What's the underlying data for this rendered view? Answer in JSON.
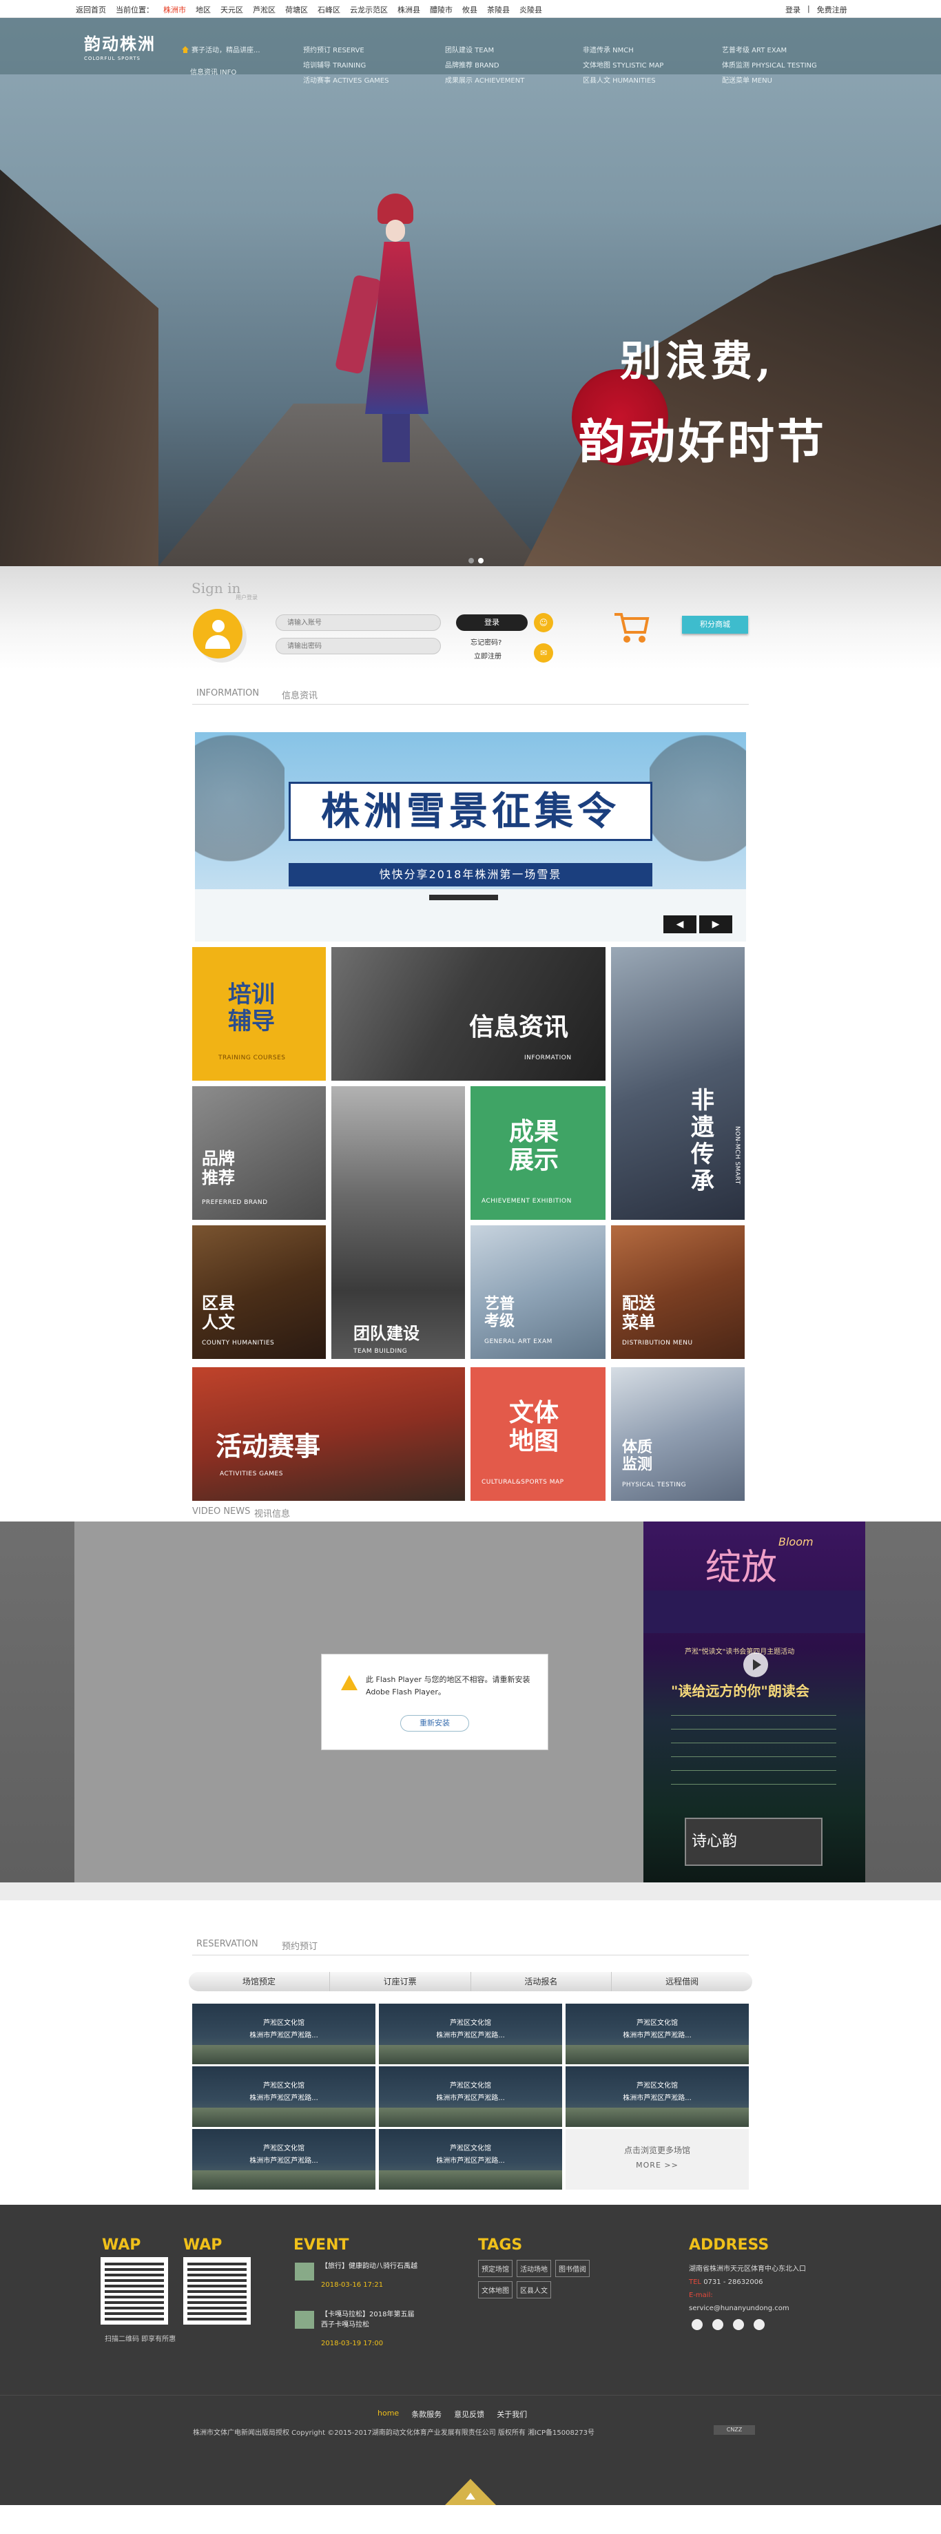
{
  "topbar": {
    "links": [
      "返回首页",
      "当前位置：",
      "株洲市",
      "地区",
      "天元区",
      "芦淞区",
      "荷塘区",
      "石峰区",
      "云龙示范区",
      "株洲县",
      "醴陵市",
      "攸县",
      "茶陵县",
      "炎陵县"
    ],
    "login": "登录",
    "divider": "|",
    "register": "免费注册"
  },
  "logo": {
    "cn": "韵动株洲",
    "en": "COLORFUL SPORTS"
  },
  "nav": {
    "home": "赛子活动，精品讲座...",
    "info": "信息资讯 INFO",
    "reserve": "预约预订 RESERVE",
    "training": "培训辅导 TRAINING",
    "activities": "活动赛事 ACTIVES GAMES",
    "team": "团队建设 TEAM",
    "brand": "品牌推荐 BRAND",
    "achievement": "成果展示 ACHIEVEMENT",
    "nmch": "非遗传承 NMCH",
    "map": "文体地图 STYLISTIC MAP",
    "humanities": "区县人文 HUMANITIES",
    "artexam": "艺普考级 ART EXAM",
    "physical": "体质监测 PHYSICAL TESTING",
    "menu": "配送菜单 MENU"
  },
  "hero": {
    "line1": "别浪费,",
    "line2": "韵动好时节"
  },
  "signin": {
    "title": "Sign in",
    "subtitle": "用户登录",
    "account_placeholder": "请输入账号",
    "password_placeholder": "请输出密码",
    "login": "登录",
    "forgot": "忘记密码?",
    "register": "立即注册",
    "points": "积分商城"
  },
  "info": {
    "en": "INFORMATION",
    "cn": "信息资讯"
  },
  "banner": {
    "title": "株洲雪景征集令",
    "subtitle": "快快分享2018年株洲第一场雪景",
    "prev": "◀",
    "next": "▶"
  },
  "tiles": [
    {
      "cn": "培训\n辅导",
      "en": "TRAINING COURSES"
    },
    {
      "cn": "信息资讯",
      "en": "INFORMATION"
    },
    {
      "cn": "非\n遗\n传\n承",
      "en": "NON-MCH SMART"
    },
    {
      "cn": "品牌\n推荐",
      "en": "PREFERRED BRAND"
    },
    {
      "cn": "成果\n展示",
      "en": "ACHIEVEMENT EXHIBITION"
    },
    {
      "cn": "区县\n人文",
      "en": "COUNTY HUMANITIES"
    },
    {
      "cn": "团队建设",
      "en": "TEAM BUILDING"
    },
    {
      "cn": "艺普\n考级",
      "en": "GENERAL ART EXAM"
    },
    {
      "cn": "配送\n菜单",
      "en": "DISTRIBUTION MENU"
    },
    {
      "cn": "活动赛事",
      "en": "ACTIVITIES GAMES"
    },
    {
      "cn": "文体\n地图",
      "en": "CULTURAL&SPORTS MAP"
    },
    {
      "cn": "体质\n监测",
      "en": "PHYSICAL TESTING"
    }
  ],
  "video": {
    "en": "VIDEO NEWS",
    "cn": "视讯信息",
    "flash_msg": "此 Flash Player 与您的地区不相容。请重新安装 Adobe Flash Player。",
    "reinstall": "重新安装",
    "poster_title": "绽放",
    "poster_en": "Bloom",
    "poster_reading": "\"读给远方的你\"朗读会",
    "poster_sub": "芦淞\"悦读文\"读书会第四月主题活动",
    "poster_screen": "诗心韵"
  },
  "reservation": {
    "en": "RESERVATION",
    "cn": "预约预订",
    "tabs": [
      "场馆预定",
      "订座订票",
      "活动报名",
      "远程借阅"
    ],
    "venue_line1": "芦淞区文化馆",
    "venue_line2": "株洲市芦淞区芦淞路...",
    "more_text": "点击浏览更多场馆",
    "more_link": "MORE >>"
  },
  "footer": {
    "wap1": "WAP",
    "wap2": "WAP",
    "qr_text": "扫描二维码  即享有所惠",
    "event_title": "EVENT",
    "event1": "【旅行】健康韵动八骑行石禹越",
    "event1_date": "2018-03-16 17:21",
    "event2": "【卡嘎马拉松】2018年第五届西子卡嘎马拉松",
    "event2_date": "2018-03-19 17:00",
    "tags_title": "TAGS",
    "tags": [
      "预定场馆",
      "活动场地",
      "图书借阅",
      "文体地图",
      "区县人文"
    ],
    "addr_title": "ADDRESS",
    "addr": "湖南省株洲市天元区体育中心东北入口",
    "tel_label": "TEL",
    "tel": "0731 - 28632006",
    "email_label": "E-mail:",
    "email": "service@hunanyundong.com",
    "links": [
      "home",
      "条款服务",
      "意见反馈",
      "关于我们"
    ],
    "copyright": "株洲市文体广电新闻出版局授权 Copyright ©2015-2017湖南韵动文化体育产业发展有限责任公司 版权所有 湘ICP备15008273号",
    "badge": "CNZZ"
  }
}
